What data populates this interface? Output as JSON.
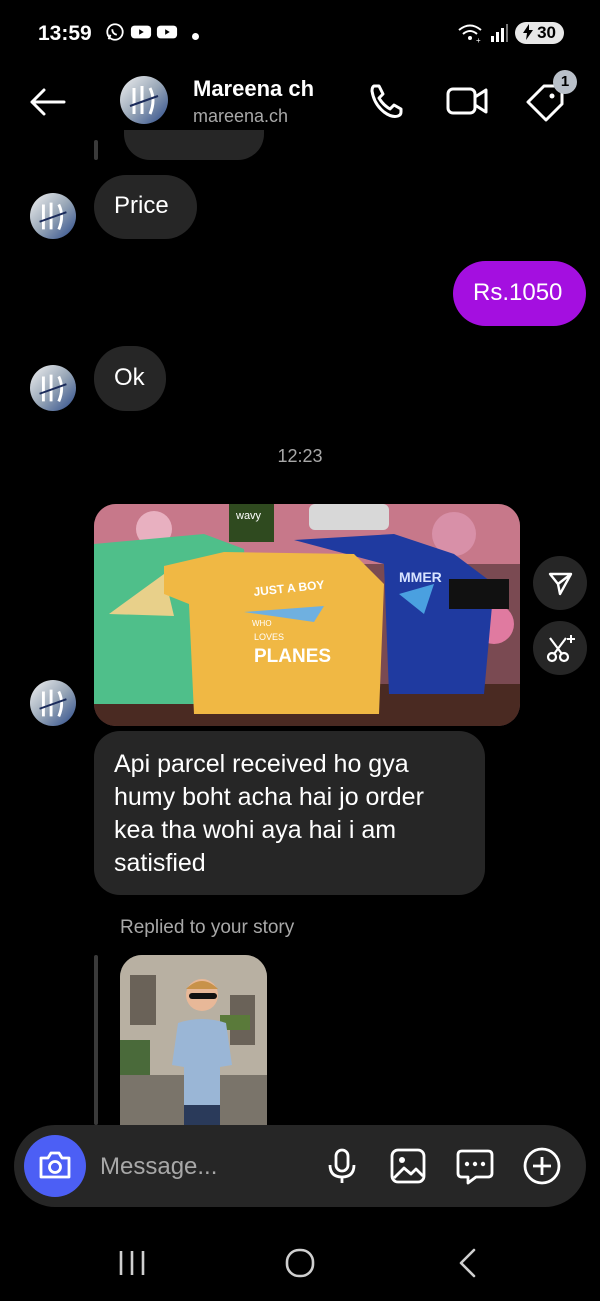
{
  "status_bar": {
    "time": "13:59",
    "battery": "30"
  },
  "header": {
    "display_name": "Mareena ch",
    "username": "mareena.ch",
    "notification_count": "1"
  },
  "messages": [
    {
      "type": "received_text",
      "text": "Price"
    },
    {
      "type": "sent_text",
      "text": "Rs.1050"
    },
    {
      "type": "received_text",
      "text": "Ok"
    },
    {
      "type": "timestamp",
      "text": "12:23"
    },
    {
      "type": "received_image",
      "image_text": {
        "shirt_1_line1": "JUST A BOY",
        "shirt_1_line2": "WHO",
        "shirt_1_line3": "LOVES",
        "shirt_1_line4": "PLANES",
        "shirt_2": "MMER",
        "tag": "wavy"
      }
    },
    {
      "type": "received_text",
      "text": "Api parcel received ho gya humy boht acha hai jo order kea tha wohi aya hai i am satisfied"
    },
    {
      "type": "story_reply",
      "label": "Replied to your story"
    }
  ],
  "composer": {
    "placeholder": "Message..."
  },
  "icons": {
    "back": "arrow-left-icon",
    "call": "phone-icon",
    "video": "video-camera-icon",
    "tag": "tag-icon",
    "share": "send-icon",
    "edit": "magic-scissors-icon",
    "camera": "camera-icon",
    "mic": "microphone-icon",
    "gallery": "image-icon",
    "sticker": "chat-dots-icon",
    "more": "plus-circle-icon"
  },
  "colors": {
    "sent_bubble": "#a40fe0",
    "received_bubble": "#262626",
    "camera_button": "#4c5ff5"
  }
}
